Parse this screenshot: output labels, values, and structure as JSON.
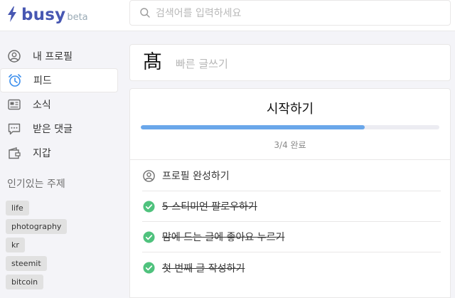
{
  "header": {
    "brand": "busy",
    "beta": "beta",
    "search_placeholder": "검색어를 입력하세요"
  },
  "sidebar": {
    "items": [
      {
        "label": "내 프로필",
        "icon": "user-circle-icon",
        "active": false
      },
      {
        "label": "피드",
        "icon": "alarm-clock-icon",
        "active": true
      },
      {
        "label": "소식",
        "icon": "news-icon",
        "active": false
      },
      {
        "label": "받은 댓글",
        "icon": "comment-icon",
        "active": false
      },
      {
        "label": "지갑",
        "icon": "wallet-icon",
        "active": false
      }
    ],
    "trending_title": "인기있는 주제",
    "tags": [
      "life",
      "photography",
      "kr",
      "steemit",
      "bitcoin"
    ]
  },
  "quick_post": {
    "avatar_char": "髙",
    "placeholder": "빠른 글쓰기"
  },
  "start": {
    "title": "시작하기",
    "progress_fraction": 0.75,
    "progress_text": "3/4 완료",
    "tasks": [
      {
        "label": "프로필 완성하기",
        "completed": false,
        "icon": "user-circle-icon"
      },
      {
        "label": "5 스티미언 팔로우하기",
        "completed": true,
        "icon": "check-circle-icon"
      },
      {
        "label": "맘에 드는 글에 좋아요 누르기",
        "completed": true,
        "icon": "check-circle-icon"
      },
      {
        "label": "첫 번째 글 작성하기",
        "completed": true,
        "icon": "check-circle-icon"
      }
    ]
  },
  "colors": {
    "brand": "#4757b2",
    "progress": "#6aa7ea",
    "check": "#4fc27d",
    "active_icon": "#3a8eed"
  }
}
